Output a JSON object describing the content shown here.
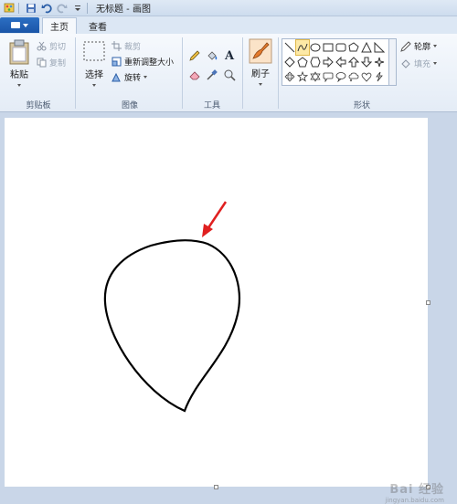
{
  "title_bar": {
    "title": "无标题 - 画图"
  },
  "tabs": {
    "home": "主页",
    "view": "查看"
  },
  "clipboard": {
    "paste": "粘贴",
    "cut": "剪切",
    "copy": "复制",
    "group": "剪贴板"
  },
  "image": {
    "select": "选择",
    "crop": "裁剪",
    "resize": "重新调整大小",
    "rotate": "旋转",
    "group": "图像"
  },
  "tools": {
    "group": "工具"
  },
  "brushes": {
    "label": "刷子"
  },
  "shapes": {
    "group": "形状",
    "outline": "轮廓",
    "fill": "填充"
  },
  "watermark": {
    "text": "Bai 经验",
    "sub": "jingyan.baidu.com"
  },
  "colors": {
    "file_tab": "#1a55a8",
    "arrow": "#e02020",
    "stroke": "#000000",
    "gallery_selected": "#fde9a6"
  }
}
